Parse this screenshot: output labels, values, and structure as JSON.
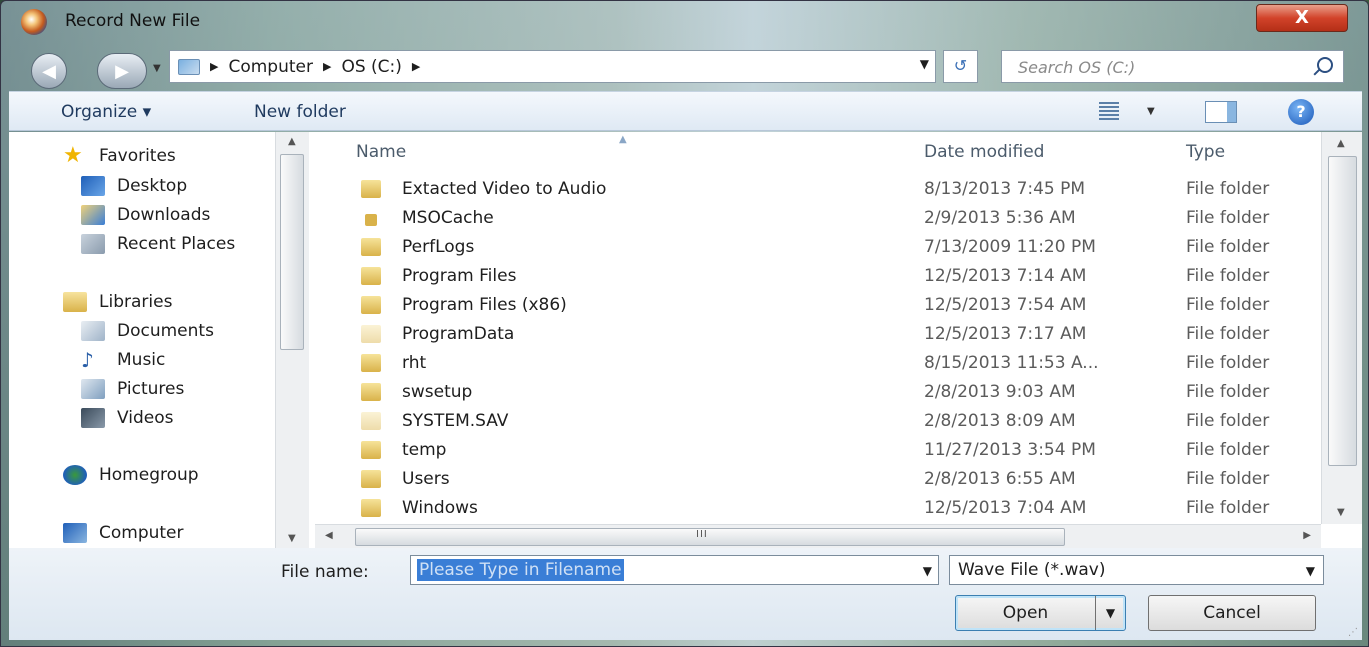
{
  "window": {
    "title": "Record New File",
    "close_label": "X"
  },
  "navbar": {
    "back_glyph": "◀",
    "forward_glyph": "▶",
    "breadcrumb": [
      "Computer",
      "OS (C:)"
    ],
    "separator": "▶",
    "refresh_glyph": "↺",
    "search_placeholder": "Search OS (C:)"
  },
  "toolbar": {
    "organize_label": "Organize ▾",
    "new_folder_label": "New folder"
  },
  "nav_pane": {
    "favorites": {
      "label": "Favorites",
      "items": [
        "Desktop",
        "Downloads",
        "Recent Places"
      ]
    },
    "libraries": {
      "label": "Libraries",
      "items": [
        "Documents",
        "Music",
        "Pictures",
        "Videos"
      ]
    },
    "homegroup": "Homegroup",
    "computer": "Computer"
  },
  "list": {
    "columns": {
      "name": "Name",
      "date": "Date modified",
      "type": "Type"
    },
    "rows": [
      {
        "name": "Extacted Video to Audio",
        "date": "8/13/2013 7:45 PM",
        "type": "File folder",
        "icon": "folder-icon"
      },
      {
        "name": "MSOCache",
        "date": "2/9/2013 5:36 AM",
        "type": "File folder",
        "icon": "locked-folder-icon"
      },
      {
        "name": "PerfLogs",
        "date": "7/13/2009 11:20 PM",
        "type": "File folder",
        "icon": "folder-icon"
      },
      {
        "name": "Program Files",
        "date": "12/5/2013 7:14 AM",
        "type": "File folder",
        "icon": "folder-icon"
      },
      {
        "name": "Program Files (x86)",
        "date": "12/5/2013 7:54 AM",
        "type": "File folder",
        "icon": "folder-icon"
      },
      {
        "name": "ProgramData",
        "date": "12/5/2013 7:17 AM",
        "type": "File folder",
        "icon": "hidden-folder-icon"
      },
      {
        "name": "rht",
        "date": "8/15/2013 11:53 A...",
        "type": "File folder",
        "icon": "folder-icon"
      },
      {
        "name": "swsetup",
        "date": "2/8/2013 9:03 AM",
        "type": "File folder",
        "icon": "folder-icon"
      },
      {
        "name": "SYSTEM.SAV",
        "date": "2/8/2013 8:09 AM",
        "type": "File folder",
        "icon": "hidden-folder-icon"
      },
      {
        "name": "temp",
        "date": "11/27/2013 3:54 PM",
        "type": "File folder",
        "icon": "folder-icon"
      },
      {
        "name": "Users",
        "date": "2/8/2013 6:55 AM",
        "type": "File folder",
        "icon": "folder-icon"
      },
      {
        "name": "Windows",
        "date": "12/5/2013 7:04 AM",
        "type": "File folder",
        "icon": "folder-icon"
      }
    ]
  },
  "bottom": {
    "file_name_label": "File name:",
    "file_name_value": "Please Type in Filename",
    "file_type_value": "Wave File (*.wav)",
    "open_label": "Open",
    "cancel_label": "Cancel"
  }
}
